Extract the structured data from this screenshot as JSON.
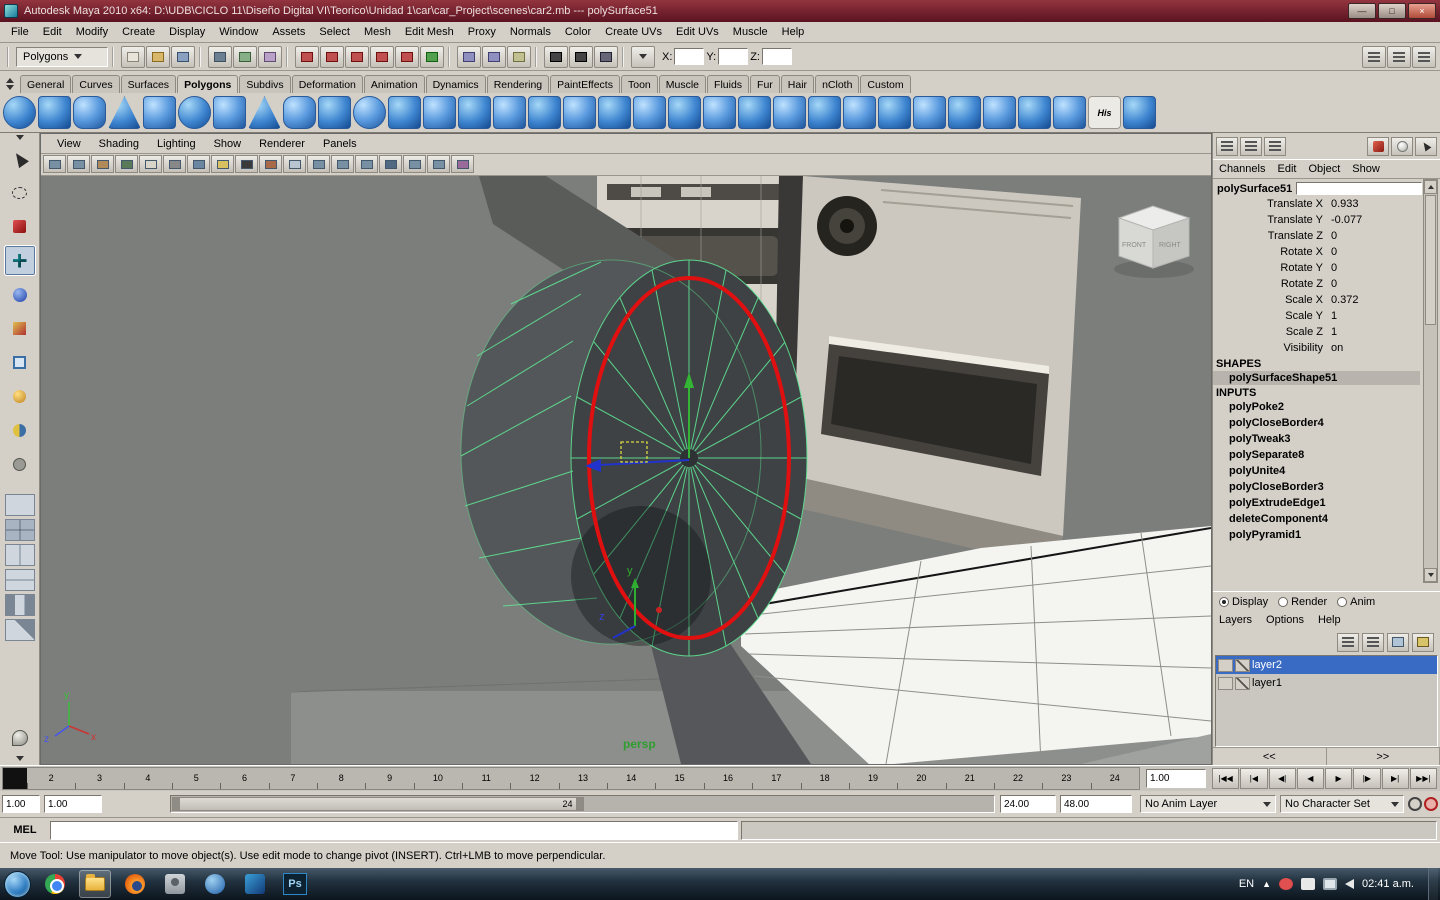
{
  "window": {
    "title": "Autodesk Maya 2010 x64: D:\\UDB\\CICLO 11\\Diseño Digital VI\\Teorico\\Unidad 1\\car\\car_Project\\scenes\\car2.mb   ---   polySurface51",
    "minimize": "—",
    "maximize": "□",
    "close": "×"
  },
  "menubar": {
    "items": [
      "File",
      "Edit",
      "Modify",
      "Create",
      "Display",
      "Window",
      "Assets",
      "Select",
      "Mesh",
      "Edit Mesh",
      "Proxy",
      "Normals",
      "Color",
      "Create UVs",
      "Edit UVs",
      "Muscle",
      "Help"
    ]
  },
  "status_line": {
    "mode": "Polygons",
    "x_label": "X:",
    "y_label": "Y:",
    "z_label": "Z:",
    "x_value": "",
    "y_value": "",
    "z_value": ""
  },
  "shelf": {
    "tabs": [
      "General",
      "Curves",
      "Surfaces",
      "Polygons",
      "Subdivs",
      "Deformation",
      "Animation",
      "Dynamics",
      "Rendering",
      "PaintEffects",
      "Toon",
      "Muscle",
      "Fluids",
      "Fur",
      "Hair",
      "nCloth",
      "Custom"
    ],
    "his_label": "His"
  },
  "viewport": {
    "menu": [
      "View",
      "Shading",
      "Lighting",
      "Show",
      "Renderer",
      "Panels"
    ],
    "camera_label": "persp",
    "viewcube_front": "FRONT",
    "viewcube_right": "RIGHT"
  },
  "channel_box": {
    "menu": [
      "Channels",
      "Edit",
      "Object",
      "Show"
    ],
    "object_name": "polySurface51",
    "attributes": [
      {
        "label": "Translate X",
        "value": "0.933"
      },
      {
        "label": "Translate Y",
        "value": "-0.077"
      },
      {
        "label": "Translate Z",
        "value": "0"
      },
      {
        "label": "Rotate X",
        "value": "0"
      },
      {
        "label": "Rotate Y",
        "value": "0"
      },
      {
        "label": "Rotate Z",
        "value": "0"
      },
      {
        "label": "Scale X",
        "value": "0.372"
      },
      {
        "label": "Scale Y",
        "value": "1"
      },
      {
        "label": "Scale Z",
        "value": "1"
      },
      {
        "label": "Visibility",
        "value": "on"
      }
    ],
    "shapes_header": "SHAPES",
    "shapes": [
      "polySurfaceShape51"
    ],
    "inputs_header": "INPUTS",
    "inputs": [
      "polyPoke2",
      "polyCloseBorder4",
      "polyTweak3",
      "polySeparate8",
      "polyUnite4",
      "polyCloseBorder3",
      "polyExtrudeEdge1",
      "deleteComponent4",
      "polyPyramid1"
    ]
  },
  "layer_panel": {
    "display_options": [
      "Display",
      "Render",
      "Anim"
    ],
    "menu": [
      "Layers",
      "Options",
      "Help"
    ],
    "layers": [
      {
        "name": "layer2"
      },
      {
        "name": "layer1"
      }
    ],
    "pager_prev": "<<",
    "pager_next": ">>"
  },
  "timeline": {
    "ticks": [
      "2",
      "3",
      "4",
      "5",
      "6",
      "7",
      "8",
      "9",
      "10",
      "11",
      "12",
      "13",
      "14",
      "15",
      "16",
      "17",
      "18",
      "19",
      "20",
      "21",
      "22",
      "23",
      "24"
    ],
    "current_time": "1.00",
    "playback": [
      "|◀◀",
      "|◀",
      "◀|",
      "◀",
      "▶",
      "|▶",
      "▶|",
      "▶▶|"
    ]
  },
  "range_slider": {
    "min": "1.00",
    "play_min": "1.00",
    "bar_label": "24",
    "play_max": "24.00",
    "max": "48.00",
    "anim_layer": "No Anim Layer",
    "character_set": "No Character Set"
  },
  "command_line": {
    "label": "MEL",
    "value": ""
  },
  "help_line": {
    "text": "Move Tool: Use manipulator to move object(s).  Use edit mode to change pivot (INSERT).  Ctrl+LMB to move perpendicular."
  },
  "taskbar": {
    "language": "EN",
    "hidden_icons": "▲",
    "ps_label": "Ps",
    "clock": "02:41 a.m."
  }
}
